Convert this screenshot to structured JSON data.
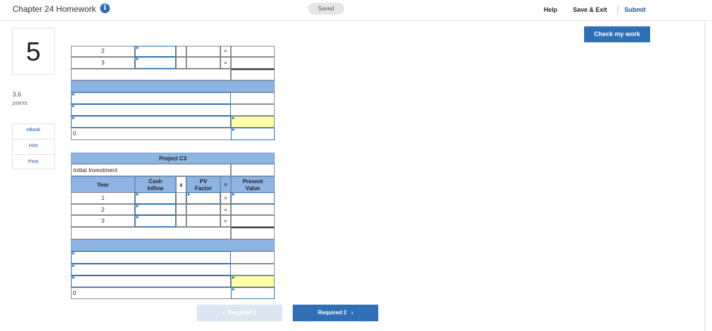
{
  "header": {
    "title": "Chapter 24 Homework",
    "saved": "Saved",
    "help": "Help",
    "save_exit": "Save & Exit",
    "submit": "Submit",
    "check_work": "Check my work"
  },
  "question": {
    "number": "5",
    "points_value": "3.6",
    "points_label": "points"
  },
  "sidebar": {
    "items": [
      {
        "label": "eBook"
      },
      {
        "label": "Hint"
      },
      {
        "label": "Print"
      }
    ]
  },
  "worksheet": {
    "top_years": [
      "2",
      "3"
    ],
    "equals": "=",
    "zero": "0",
    "project_title": "Project C3",
    "initial_investment": "Initial Investment",
    "headers": {
      "year": "Year",
      "cash_inflow_1": "Cash",
      "cash_inflow_2": "Inflow",
      "times": "x",
      "pv_factor_1": "PV",
      "pv_factor_2": "Factor",
      "equals": "=",
      "present_value_1": "Present",
      "present_value_2": "Value"
    },
    "years": [
      "1",
      "2",
      "3"
    ]
  },
  "navigation": {
    "prev": "Required 1",
    "next": "Required 2"
  },
  "colors": {
    "accent": "#2f6fb5",
    "header_band": "#8db4e2",
    "highlight": "#ffffa8"
  }
}
